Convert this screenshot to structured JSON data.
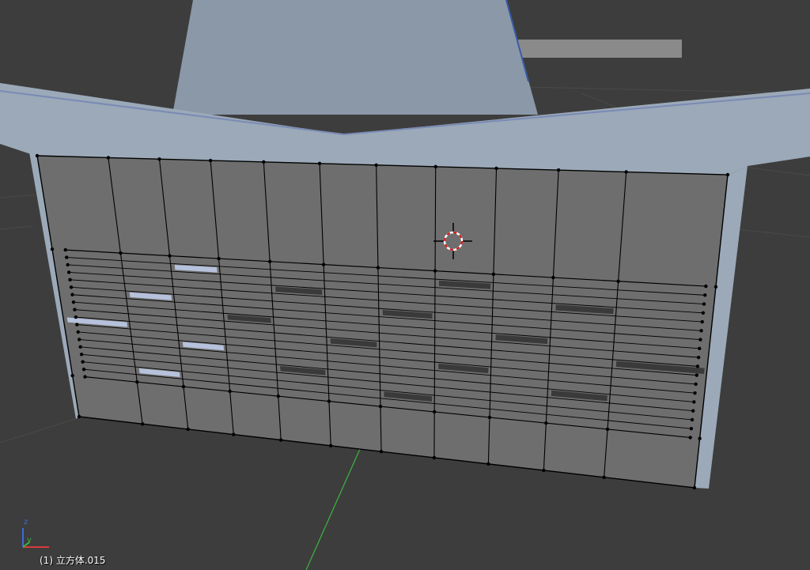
{
  "viewport": {
    "object_info": "(1) 立方体.015",
    "axis_labels": {
      "x": "x",
      "y": "y",
      "z": "z"
    },
    "colors": {
      "background": "#3d3d3d",
      "building_light": "#8a98a8",
      "building_roof": "#9ba9b8",
      "facade_face": "#6e6e6e",
      "facade_edge": "#000000",
      "vertex": "#000000",
      "window_dark": "#3a3a3a",
      "window_light": "#b6c2dc",
      "axis_x": "#d83a3a",
      "axis_y": "#3fb43f",
      "axis_z": "#3a6bd8",
      "cursor_red": "#d02020",
      "cursor_white": "#ffffff"
    },
    "icons": [
      "3d-cursor-icon",
      "axis-gizmo-icon"
    ]
  }
}
